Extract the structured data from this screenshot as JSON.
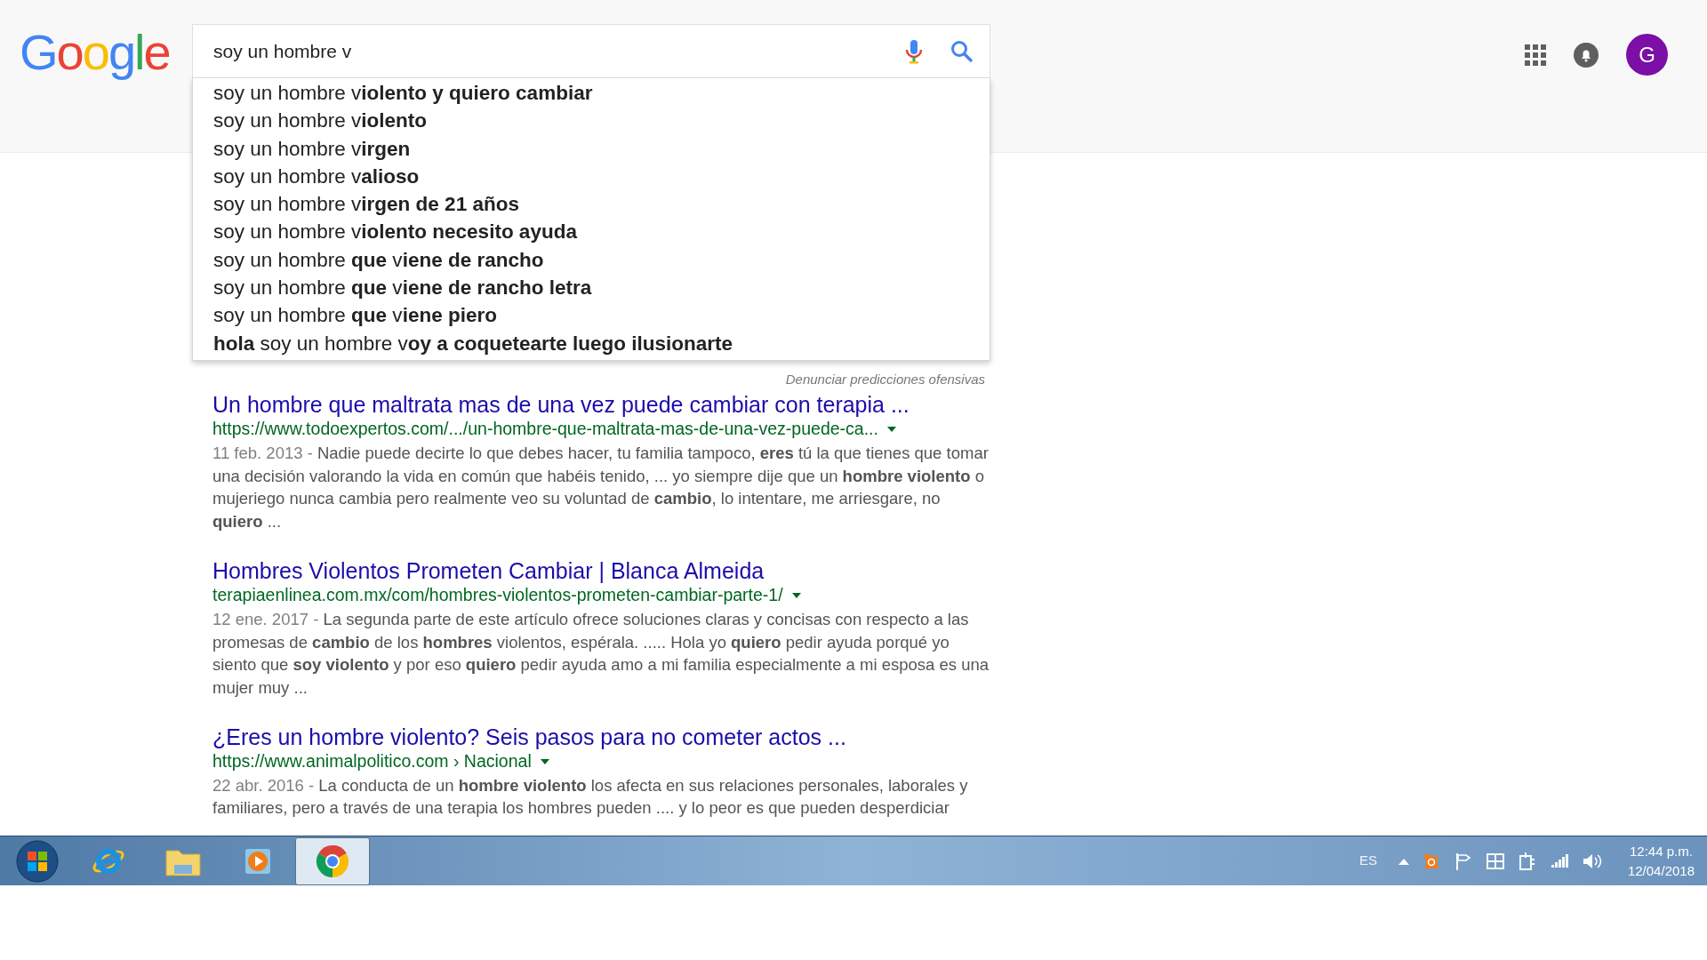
{
  "logo": "Google",
  "search": {
    "value": "soy un hombre v"
  },
  "suggestions": [
    "soy un hombre v**iolento y quiero cambiar**",
    "soy un hombre v**iolento**",
    "soy un hombre v**irgen**",
    "soy un hombre v**alioso**",
    "soy un hombre v**irgen de 21 años**",
    "soy un hombre v**iolento necesito ayuda**",
    "soy un hombre **que** v**iene de rancho**",
    "soy un hombre **que** v**iene de rancho letra**",
    "soy un hombre **que** v**iene piero**",
    "**hola** soy un hombre v**oy a coquetearte luego ilusionarte**"
  ],
  "report_link": "Denunciar predicciones ofensivas",
  "account": {
    "initial": "G"
  },
  "results": [
    {
      "title": "Un hombre que maltrata mas de una vez puede cambiar con terapia ...",
      "url": "https://www.todoexpertos.com/.../un-hombre-que-maltrata-mas-de-una-vez-puede-ca...",
      "date": "11 feb. 2013 - ",
      "snippet": "Nadie puede decirte lo que debes hacer, tu familia tampoco, **eres** tú la que tienes que tomar una decisión valorando la vida en común que habéis tenido, ... yo siempre dije que un **hombre violento** o mujeriego nunca cambia pero realmente veo su voluntad de **cambio**, lo intentare, me arriesgare, no **quiero** ..."
    },
    {
      "title": "Hombres Violentos Prometen Cambiar | Blanca Almeida",
      "url": "terapiaenlinea.com.mx/com/hombres-violentos-prometen-cambiar-parte-1/",
      "date": "12 ene. 2017 - ",
      "snippet": "La segunda parte de este artículo ofrece soluciones claras y concisas con respecto a las promesas de **cambio** de los **hombres** violentos, espérala. ..... Hola yo **quiero** pedir ayuda porqué yo siento que **soy violento** y por eso **quiero** pedir ayuda amo a mi familia especialmente a mi esposa es una mujer muy ..."
    },
    {
      "title": "¿Eres un hombre violento? Seis pasos para no cometer actos ...",
      "url": "https://www.animalpolitico.com › Nacional",
      "date": "22 abr. 2016 - ",
      "snippet": "La conducta de un **hombre violento** los afecta en sus relaciones personales, laborales y familiares, pero a través de una terapia los hombres pueden .... y lo peor es que pueden desperdiciar"
    }
  ],
  "taskbar": {
    "apps": [
      {
        "kind": "ie",
        "selected": false
      },
      {
        "kind": "folder",
        "selected": false
      },
      {
        "kind": "media",
        "selected": false
      },
      {
        "kind": "chrome",
        "selected": true
      }
    ],
    "language": "ES",
    "time": "12:44 p.m.",
    "date": "12/04/2018"
  }
}
